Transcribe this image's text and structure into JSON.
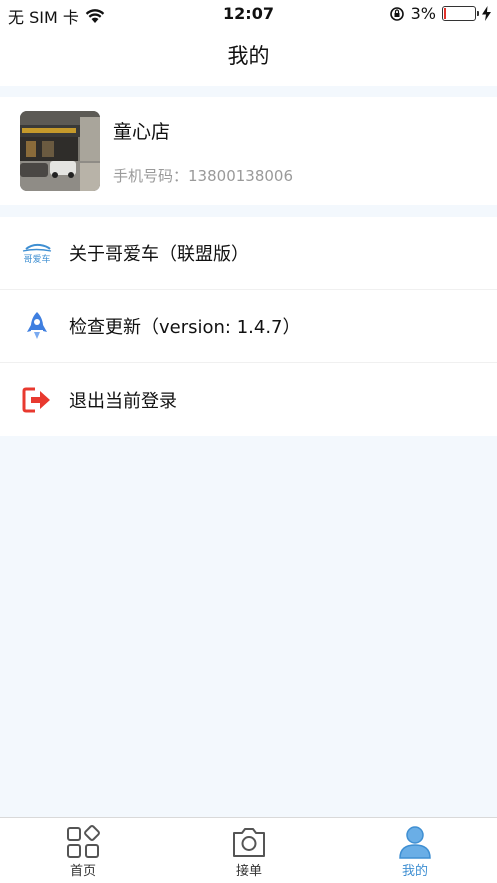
{
  "status_bar": {
    "carrier": "无 SIM 卡",
    "time": "12:07",
    "battery": "3%"
  },
  "nav": {
    "title": "我的"
  },
  "profile": {
    "store_name": "童心店",
    "phone_label": "手机号码：",
    "phone_number": "13800138006"
  },
  "menu": {
    "items": [
      {
        "label": "关于哥爱车（联盟版）",
        "icon": "brand-logo-icon",
        "logo_text": "哥爱车"
      },
      {
        "label": "检查更新（version: 1.4.7）",
        "icon": "rocket-icon"
      },
      {
        "label": "退出当前登录",
        "icon": "logout-icon"
      }
    ]
  },
  "tab_bar": {
    "tabs": [
      {
        "label": "首页",
        "icon": "home-grid-icon"
      },
      {
        "label": "接单",
        "icon": "camera-icon"
      },
      {
        "label": "我的",
        "icon": "user-icon",
        "active": true
      }
    ]
  },
  "colors": {
    "accent": "#3f8fd2",
    "logout": "#e8392f",
    "rocket": "#3f7fe0",
    "background": "#f3f8fd"
  }
}
